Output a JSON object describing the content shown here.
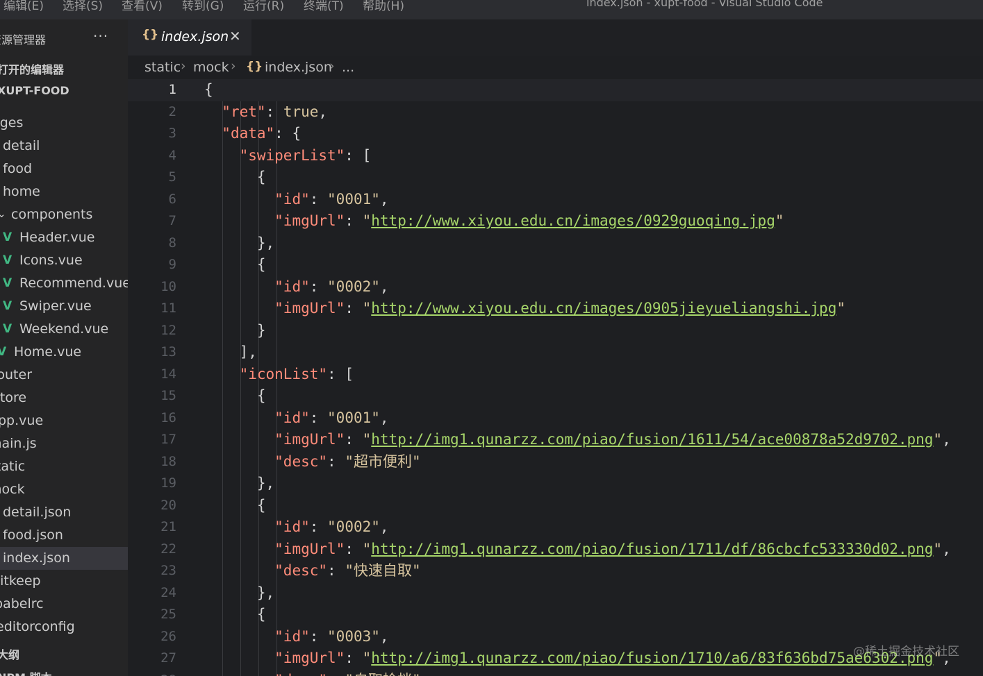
{
  "menubar": {
    "items": [
      "编辑(E)",
      "选择(S)",
      "查看(V)",
      "转到(G)",
      "运行(R)",
      "终端(T)",
      "帮助(H)"
    ],
    "window_title": "index.json - xupt-food - Visual Studio Code"
  },
  "sidebar": {
    "title": "资源管理器",
    "more_icon": "ellipsis-icon",
    "open_editors": "打开的编辑器",
    "project": "XUPT-FOOD",
    "items": [
      {
        "label": "pages",
        "icon": ""
      },
      {
        "label": "detail",
        "icon": ""
      },
      {
        "label": "food",
        "icon": ""
      },
      {
        "label": "home",
        "icon": ""
      },
      {
        "label": "components",
        "icon": "chevron-down-icon"
      },
      {
        "label": "Header.vue",
        "icon": "vue-icon"
      },
      {
        "label": "Icons.vue",
        "icon": "vue-icon"
      },
      {
        "label": "Recommend.vue",
        "icon": "vue-icon"
      },
      {
        "label": "Swiper.vue",
        "icon": "vue-icon"
      },
      {
        "label": "Weekend.vue",
        "icon": "vue-icon"
      },
      {
        "label": "Home.vue",
        "icon": "vue-icon"
      },
      {
        "label": "router",
        "icon": ""
      },
      {
        "label": "store",
        "icon": ""
      },
      {
        "label": "App.vue",
        "icon": ""
      },
      {
        "label": "main.js",
        "icon": ""
      },
      {
        "label": "static",
        "icon": ""
      },
      {
        "label": "mock",
        "icon": ""
      },
      {
        "label": "detail.json",
        "icon": ""
      },
      {
        "label": "food.json",
        "icon": ""
      },
      {
        "label": "index.json",
        "icon": "",
        "selected": true
      },
      {
        "label": ".gitkeep",
        "icon": ""
      },
      {
        "label": ".babelrc",
        "icon": ""
      },
      {
        "label": ".editorconfig",
        "icon": ""
      }
    ],
    "bottom_sections": [
      "大纲",
      "NPM 脚本"
    ]
  },
  "tab": {
    "label": "index.json",
    "icon": "json-braces-icon",
    "close_icon": "close-icon"
  },
  "breadcrumb": {
    "parts": [
      "static",
      "mock",
      "index.json",
      "..."
    ]
  },
  "editor": {
    "current_line": 1,
    "lines": [
      "{",
      "  \"ret\": true,",
      "  \"data\": {",
      "    \"swiperList\": [",
      "      {",
      "        \"id\": \"0001\",",
      "        \"imgUrl\": \"http://www.xiyou.edu.cn/images/0929guoqing.jpg\"",
      "      },",
      "      {",
      "        \"id\": \"0002\",",
      "        \"imgUrl\": \"http://www.xiyou.edu.cn/images/0905jieyueliangshi.jpg\"",
      "      }",
      "    ],",
      "    \"iconList\": [",
      "      {",
      "        \"id\": \"0001\",",
      "        \"imgUrl\": \"http://img1.qunarzz.com/piao/fusion/1611/54/ace00878a52d9702.png\",",
      "        \"desc\": \"超市便利\"",
      "      },",
      "      {",
      "        \"id\": \"0002\",",
      "        \"imgUrl\": \"http://img1.qunarzz.com/piao/fusion/1711/df/86cbcfc533330d02.png\",",
      "        \"desc\": \"快速自取\"",
      "      },",
      "      {",
      "        \"id\": \"0003\",",
      "        \"imgUrl\": \"http://img1.qunarzz.com/piao/fusion/1710/a6/83f636bd75ae6302.png\",",
      "        \"desc\": \"自取检档\""
    ]
  },
  "watermark": "@稀土掘金技术社区",
  "colors": {
    "key": "#ff8c7a",
    "string": "#d7c49e",
    "url": "#a7d66a",
    "vue": "#41b883",
    "json_icon": "#e2c08d"
  }
}
